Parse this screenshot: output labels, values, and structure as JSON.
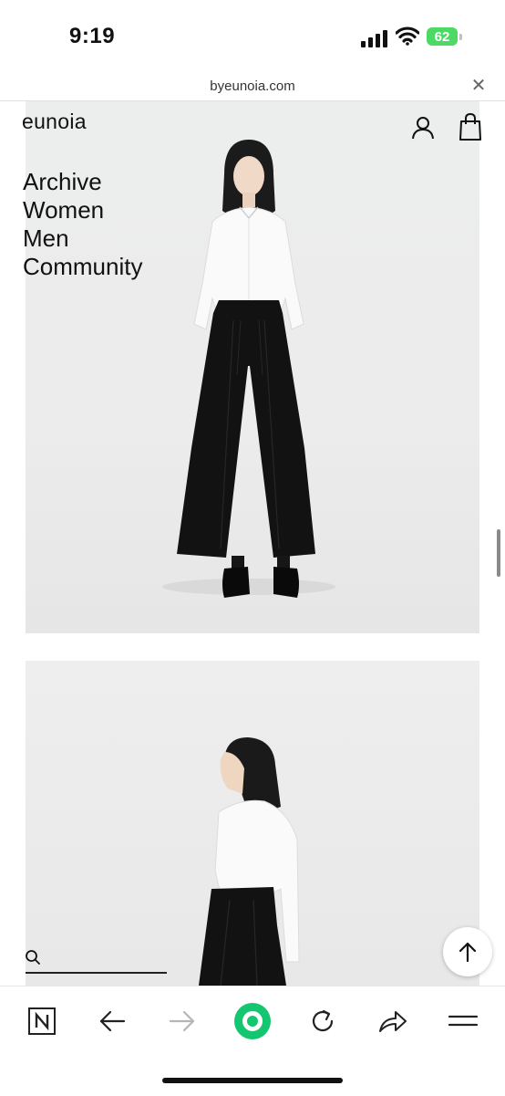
{
  "status_bar": {
    "time": "9:19",
    "battery_level": "62",
    "battery_color": "#4cd964"
  },
  "address_bar": {
    "url": "byeunoia.com",
    "close_icon": "close-icon"
  },
  "site": {
    "logo": "eunoia",
    "nav": [
      "Archive",
      "Women",
      "Men",
      "Community"
    ],
    "account_icon": "user-icon",
    "cart_icon": "shopping-bag-icon"
  },
  "content": {
    "images": [
      {
        "subject": "model-front-white-shirt-black-wide-trousers"
      },
      {
        "subject": "model-side-white-shirt-black-skirt"
      }
    ],
    "search_icon": "search-icon",
    "scroll_top_icon": "arrow-up-icon"
  },
  "browser_toolbar": {
    "buttons": [
      "naver-logo-icon",
      "back-arrow-icon",
      "forward-arrow-icon",
      "green-dot-icon",
      "reload-icon",
      "share-icon",
      "menu-icon"
    ],
    "accent": "#13c66f"
  }
}
